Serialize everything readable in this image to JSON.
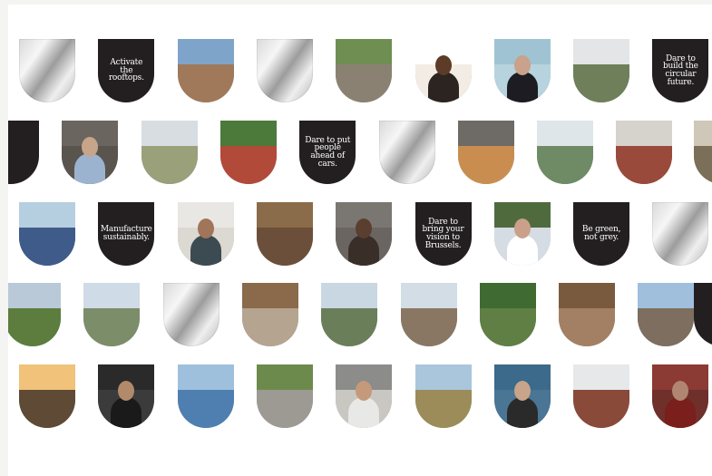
{
  "rows": [
    [
      {
        "kind": "mirror",
        "name": "mirror-tile"
      },
      {
        "kind": "dark",
        "name": "slogan-tile",
        "text": "Activate the rooftops."
      },
      {
        "kind": "photo",
        "name": "city-rooftop-photo",
        "sky": "#7fa4c9",
        "ground": "#a0795a"
      },
      {
        "kind": "mirror",
        "name": "mirror-tile"
      },
      {
        "kind": "photo",
        "name": "street-market-photo",
        "sky": "#6f8f52",
        "ground": "#8a8172"
      },
      {
        "kind": "photo",
        "name": "two-women-portrait",
        "sky": "#ffffff",
        "ground": "#f2ece5",
        "fig": "#2b2420",
        "head": "#5c3b27"
      },
      {
        "kind": "photo",
        "name": "man-bowler-hat-portrait",
        "sky": "#9fc3d3",
        "ground": "#b7d3dd",
        "fig": "#1c1c22",
        "head": "#caa18a"
      },
      {
        "kind": "photo",
        "name": "city-skyline-photo",
        "sky": "#e3e5e6",
        "ground": "#6e7f5a"
      },
      {
        "kind": "dark",
        "name": "slogan-tile",
        "text": "Dare to build the circular future."
      }
    ],
    [
      {
        "kind": "dark",
        "name": "slogan-tile",
        "text": ""
      },
      {
        "kind": "photo",
        "name": "woman-portrait",
        "sky": "#6b6560",
        "ground": "#5a544f",
        "fig": "#9bb3cf",
        "head": "#c7a58a"
      },
      {
        "kind": "photo",
        "name": "church-square-photo",
        "sky": "#d8dde2",
        "ground": "#9aa07a"
      },
      {
        "kind": "photo",
        "name": "street-cafe-photo",
        "sky": "#4b7a3a",
        "ground": "#b24a3a"
      },
      {
        "kind": "dark",
        "name": "slogan-tile",
        "text": "Dare to put people ahead of cars."
      },
      {
        "kind": "mirror",
        "name": "mirror-tile"
      },
      {
        "kind": "photo",
        "name": "modern-building-photo",
        "sky": "#6e6a66",
        "ground": "#c98e4f"
      },
      {
        "kind": "photo",
        "name": "glass-hall-photo",
        "sky": "#dfe6ea",
        "ground": "#6f8b66"
      },
      {
        "kind": "photo",
        "name": "brick-building-photo",
        "sky": "#d6d2cc",
        "ground": "#9a4a3a"
      },
      {
        "kind": "photo",
        "name": "facade-photo",
        "sky": "#cfc7b8",
        "ground": "#7b6f5a"
      }
    ],
    [
      {
        "kind": "photo",
        "name": "solar-roof-photo",
        "sky": "#b6cfe0",
        "ground": "#3e5b8a"
      },
      {
        "kind": "dark",
        "name": "slogan-tile",
        "text": "Manufacture sustainably."
      },
      {
        "kind": "photo",
        "name": "two-people-portrait",
        "sky": "#e9e7e3",
        "ground": "#dcd8d2",
        "fig": "#3c4a52",
        "head": "#a0755a"
      },
      {
        "kind": "photo",
        "name": "market-hall-photo",
        "sky": "#8a6b4a",
        "ground": "#6c4f3a"
      },
      {
        "kind": "photo",
        "name": "man-hat-portrait",
        "sky": "#7a7773",
        "ground": "#6a6560",
        "fig": "#3a2f28",
        "head": "#5a3e2f"
      },
      {
        "kind": "dark",
        "name": "slogan-tile",
        "text": "Dare to bring your vision to Brussels."
      },
      {
        "kind": "photo",
        "name": "man-cap-portrait",
        "sky": "#4f6b3e",
        "ground": "#d5dce4",
        "fig": "#ffffff",
        "head": "#caa08a"
      },
      {
        "kind": "dark",
        "name": "slogan-tile",
        "text": "Be green, not grey."
      },
      {
        "kind": "mirror",
        "name": "mirror-tile"
      }
    ],
    [
      {
        "kind": "photo",
        "name": "garden-photo",
        "sky": "#b9c9d8",
        "ground": "#5c7d3e"
      },
      {
        "kind": "photo",
        "name": "white-house-photo",
        "sky": "#cfdbe6",
        "ground": "#7c8d6a"
      },
      {
        "kind": "mirror",
        "name": "mirror-tile"
      },
      {
        "kind": "photo",
        "name": "hall-interior-photo",
        "sky": "#8a6a4a",
        "ground": "#b5a48f"
      },
      {
        "kind": "photo",
        "name": "greenhouse-photo",
        "sky": "#c8d7e2",
        "ground": "#6b7e5a"
      },
      {
        "kind": "photo",
        "name": "canal-houses-photo",
        "sky": "#d2dde6",
        "ground": "#8a7763"
      },
      {
        "kind": "photo",
        "name": "park-trees-photo",
        "sky": "#3f6a32",
        "ground": "#5f7f44"
      },
      {
        "kind": "photo",
        "name": "restaurant-photo",
        "sky": "#7a5a3e",
        "ground": "#a38064"
      },
      {
        "kind": "photo",
        "name": "street-stalls-photo",
        "sky": "#9fbfdc",
        "ground": "#7d6e60"
      },
      {
        "kind": "dark",
        "name": "slogan-tile",
        "text": ""
      }
    ],
    [
      {
        "kind": "photo",
        "name": "sunset-crowd-photo",
        "sky": "#f0c27a",
        "ground": "#5e4a35"
      },
      {
        "kind": "photo",
        "name": "three-women-portrait",
        "sky": "#2a2a2a",
        "ground": "#3b3b3b",
        "fig": "#1a1a1a",
        "head": "#b08a6a"
      },
      {
        "kind": "photo",
        "name": "square-chairs-photo",
        "sky": "#9ec0dc",
        "ground": "#4f7fb0"
      },
      {
        "kind": "photo",
        "name": "park-path-photo",
        "sky": "#6c8a4c",
        "ground": "#9c9a92"
      },
      {
        "kind": "photo",
        "name": "man-glasses-portrait",
        "sky": "#8c8c8a",
        "ground": "#c9c7c2",
        "fig": "#e8e8e6",
        "head": "#c49a7a"
      },
      {
        "kind": "photo",
        "name": "pavilion-photo",
        "sky": "#a9c6dc",
        "ground": "#9c8c5a"
      },
      {
        "kind": "photo",
        "name": "woman-grey-hair-portrait",
        "sky": "#3b6a8a",
        "ground": "#4a7594",
        "fig": "#2a2a2a",
        "head": "#c8a48a"
      },
      {
        "kind": "photo",
        "name": "white-facade-photo",
        "sky": "#e6e8ea",
        "ground": "#8a4a3a"
      },
      {
        "kind": "photo",
        "name": "bearded-man-portrait",
        "sky": "#8c3a34",
        "ground": "#6f2f2a",
        "fig": "#7a1f1c",
        "head": "#b08670"
      }
    ]
  ]
}
